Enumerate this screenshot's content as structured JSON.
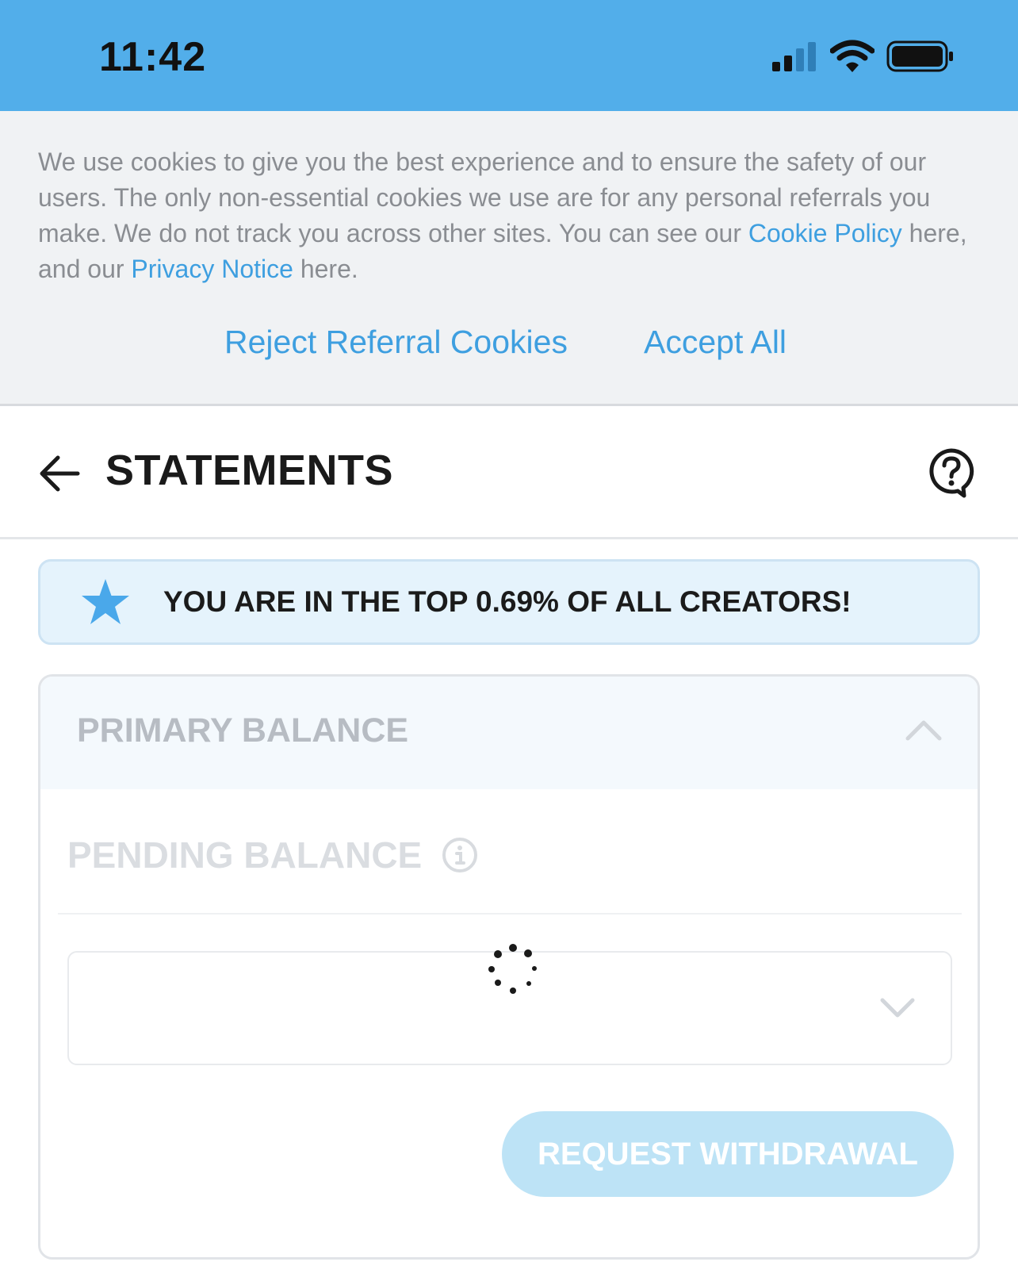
{
  "status_bar": {
    "time": "11:42"
  },
  "cookie_banner": {
    "text_1": "We use cookies to give you the best experience and to ensure the safety of our users. The only non-essential cookies we use are for any personal referrals you make. We do not track you across other sites. You can see our ",
    "cookie_policy_link": "Cookie Policy",
    "text_2": " here, and our ",
    "privacy_notice_link": "Privacy Notice",
    "text_3": " here.",
    "reject_label": "Reject Referral Cookies",
    "accept_label": "Accept All"
  },
  "header": {
    "title": "STATEMENTS"
  },
  "top_banner": {
    "text": "YOU ARE IN THE TOP 0.69% OF ALL CREATORS!"
  },
  "balance_card": {
    "primary_title": "PRIMARY BALANCE",
    "pending_title": "PENDING BALANCE",
    "withdraw_label": "REQUEST WITHDRAWAL"
  },
  "colors": {
    "status_bar": "#52aeea",
    "link": "#3e9fe0",
    "star": "#4aa8ea",
    "withdraw_button": "#bde3f6"
  }
}
